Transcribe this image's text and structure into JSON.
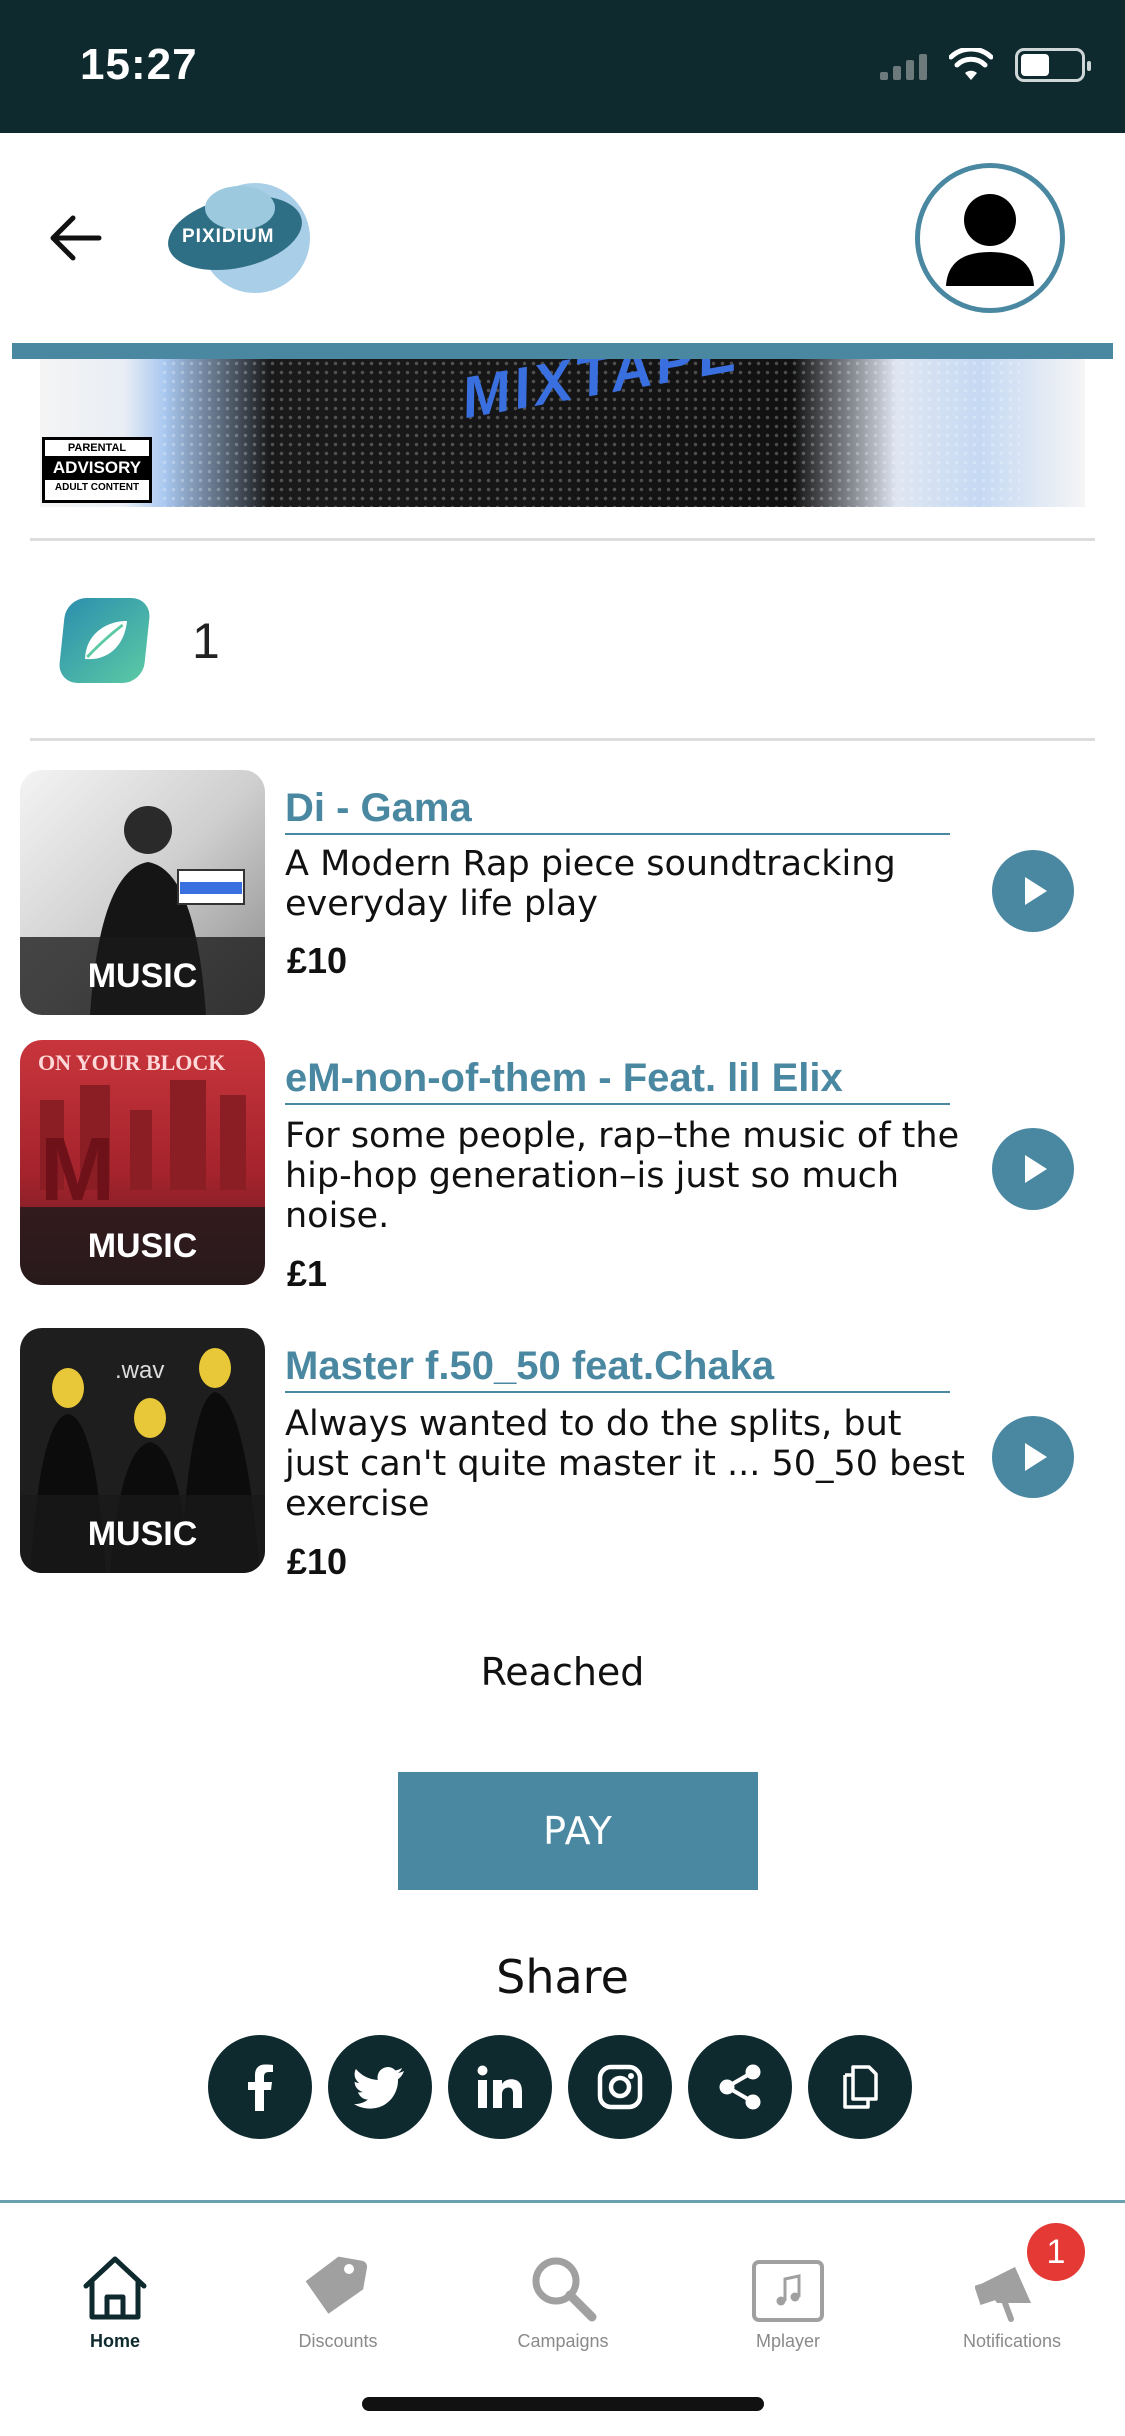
{
  "status": {
    "time": "15:27"
  },
  "header": {
    "logo_text": "PIXIDIUM"
  },
  "banner": {
    "graffiti": "MIXTAPE",
    "advisory_top": "PARENTAL",
    "advisory_mid": "ADVISORY",
    "advisory_bot": "ADULT CONTENT"
  },
  "leaf": {
    "count": "1"
  },
  "tracks": [
    {
      "title": "Di - Gama",
      "description": "A Modern Rap piece soundtracking everyday life play",
      "price": "£10",
      "badge": "MUSIC"
    },
    {
      "title": "eM-non-of-them - Feat. lil Elix",
      "description": "For some people, rap–the music of the hip-hop generation–is just so much noise.",
      "price": "£1",
      "badge": "MUSIC"
    },
    {
      "title": "Master f.50_50 feat.Chaka",
      "description": "Always wanted to do the splits, but just can't quite master it ... 50_50 best exercise",
      "price": "£10",
      "badge": "MUSIC"
    }
  ],
  "reached_label": "Reached",
  "pay_label": "PAY",
  "share": {
    "title": "Share",
    "buttons": [
      "facebook-icon",
      "twitter-icon",
      "linkedin-icon",
      "instagram-icon",
      "share-icon",
      "copy-icon"
    ]
  },
  "nav": {
    "items": [
      {
        "label": "Home",
        "icon": "home-icon",
        "active": true
      },
      {
        "label": "Discounts",
        "icon": "tag-icon"
      },
      {
        "label": "Campaigns",
        "icon": "search-icon"
      },
      {
        "label": "Mplayer",
        "icon": "music-icon"
      },
      {
        "label": "Notifications",
        "icon": "megaphone-icon"
      }
    ],
    "notifications_count": "1"
  },
  "colors": {
    "accent": "#4a88a2",
    "dark": "#0f2a2e",
    "badge": "#e53935"
  }
}
